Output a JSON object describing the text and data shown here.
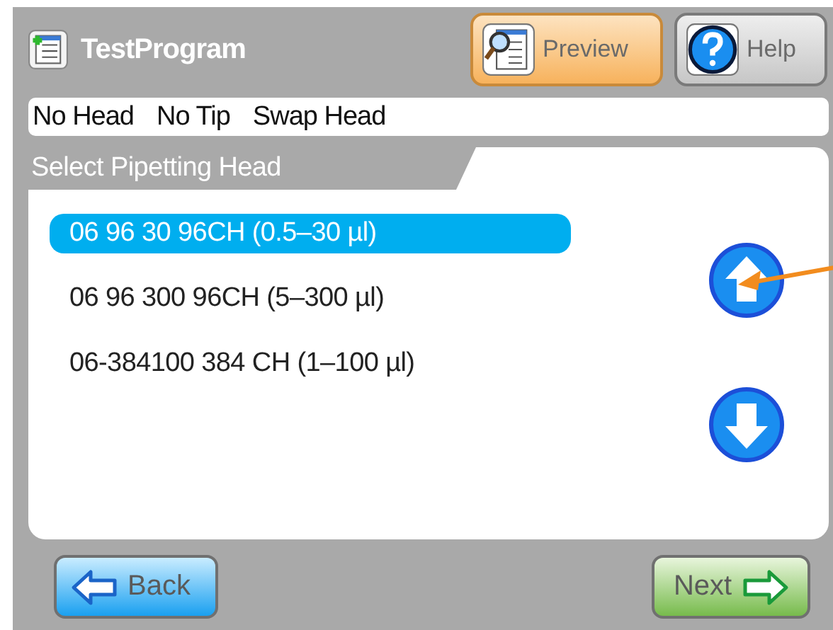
{
  "window": {
    "title": "TestProgram"
  },
  "toolbar": [
    {
      "label": "Preview",
      "kind": "preview",
      "active": true
    },
    {
      "label": "Help",
      "kind": "help",
      "active": false
    }
  ],
  "status_bar": [
    "No Head",
    "No Tip",
    "Swap Head"
  ],
  "section": {
    "title": "Select Pipetting Head",
    "items": [
      {
        "label": "06 96 30 96CH (0.5–30 µl)",
        "selected": true
      },
      {
        "label": "06 96 300 96CH (5–300 µl)",
        "selected": false
      },
      {
        "label": "06-384100 384 CH (1–100 µl)",
        "selected": false
      }
    ]
  },
  "nav_buttons": [
    {
      "label": "Back",
      "kind": "back"
    },
    {
      "label": "Next",
      "kind": "next"
    }
  ]
}
